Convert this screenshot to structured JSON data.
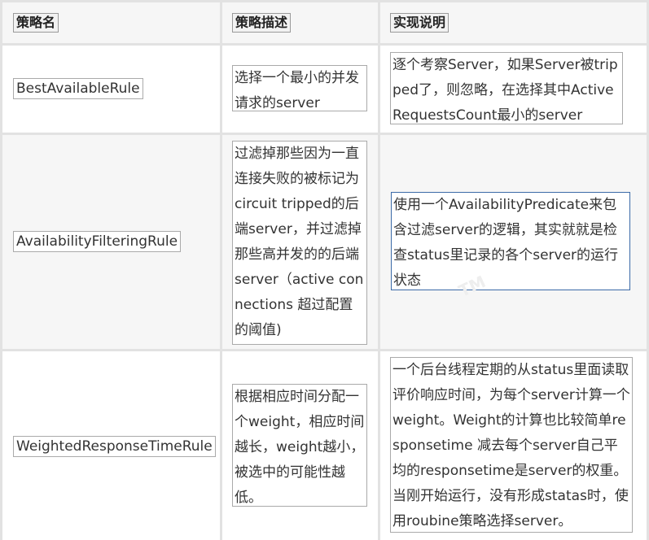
{
  "headers": {
    "name": "策略名",
    "desc": "策略描述",
    "impl": "实现说明"
  },
  "rows": [
    {
      "name": "BestAvailableRule",
      "desc": "选择一个最小的并发请求的server",
      "impl": "逐个考察Server，如果Server被tripped了，则忽略，在选择其中ActiveRequestsCount最小的server"
    },
    {
      "name": "AvailabilityFilteringRule",
      "desc": "过滤掉那些因为一直连接失败的被标记为circuit tripped的后端server，并过滤掉那些高并发的的后端server（active connections 超过配置的阈值)",
      "impl": "使用一个AvailabilityPredicate来包含过滤server的逻辑，其实就就是检查status里记录的各个server的运行状态"
    },
    {
      "name": "WeightedResponseTimeRule",
      "desc": "根据相应时间分配一个weight，相应时间越长，weight越小，被选中的可能性越低。",
      "impl": "一个后台线程定期的从status里面读取评价响应时间，为每个server计算一个weight。Weight的计算也比较简单responsetime 减去每个server自己平均的responsetime是server的权重。当刚开始运行，没有形成statas时，使用roubine策略选择server。"
    }
  ]
}
